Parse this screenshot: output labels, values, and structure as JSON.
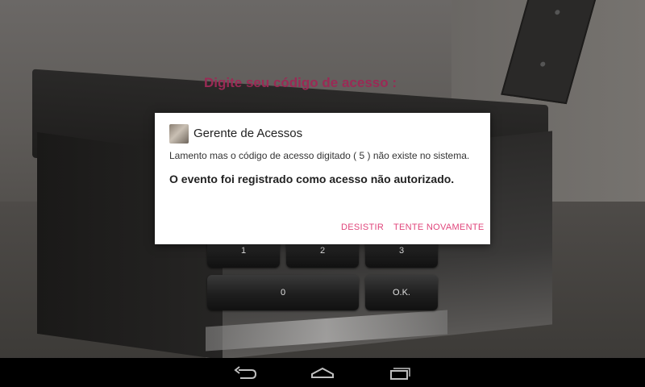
{
  "screen": {
    "prompt": "Digite seu código de acesso  :"
  },
  "keypad": {
    "keys": [
      "1",
      "2",
      "3",
      "0",
      "O.K."
    ]
  },
  "dialog": {
    "title": "Gerente de Acessos",
    "message": "Lamento mas o código de acesso digitado ( 5 ) não existe no sistema.",
    "message_bold": "O evento foi registrado como acesso não autorizado.",
    "buttons": {
      "cancel": "DESISTIR",
      "retry": "TENTE NOVAMENTE"
    },
    "button_color": "#e0457b"
  },
  "navbar": {
    "back_icon": "back-icon",
    "home_icon": "home-icon",
    "recents_icon": "recents-icon"
  },
  "colors": {
    "prompt": "#9a2a55",
    "accent": "#e0457b"
  }
}
